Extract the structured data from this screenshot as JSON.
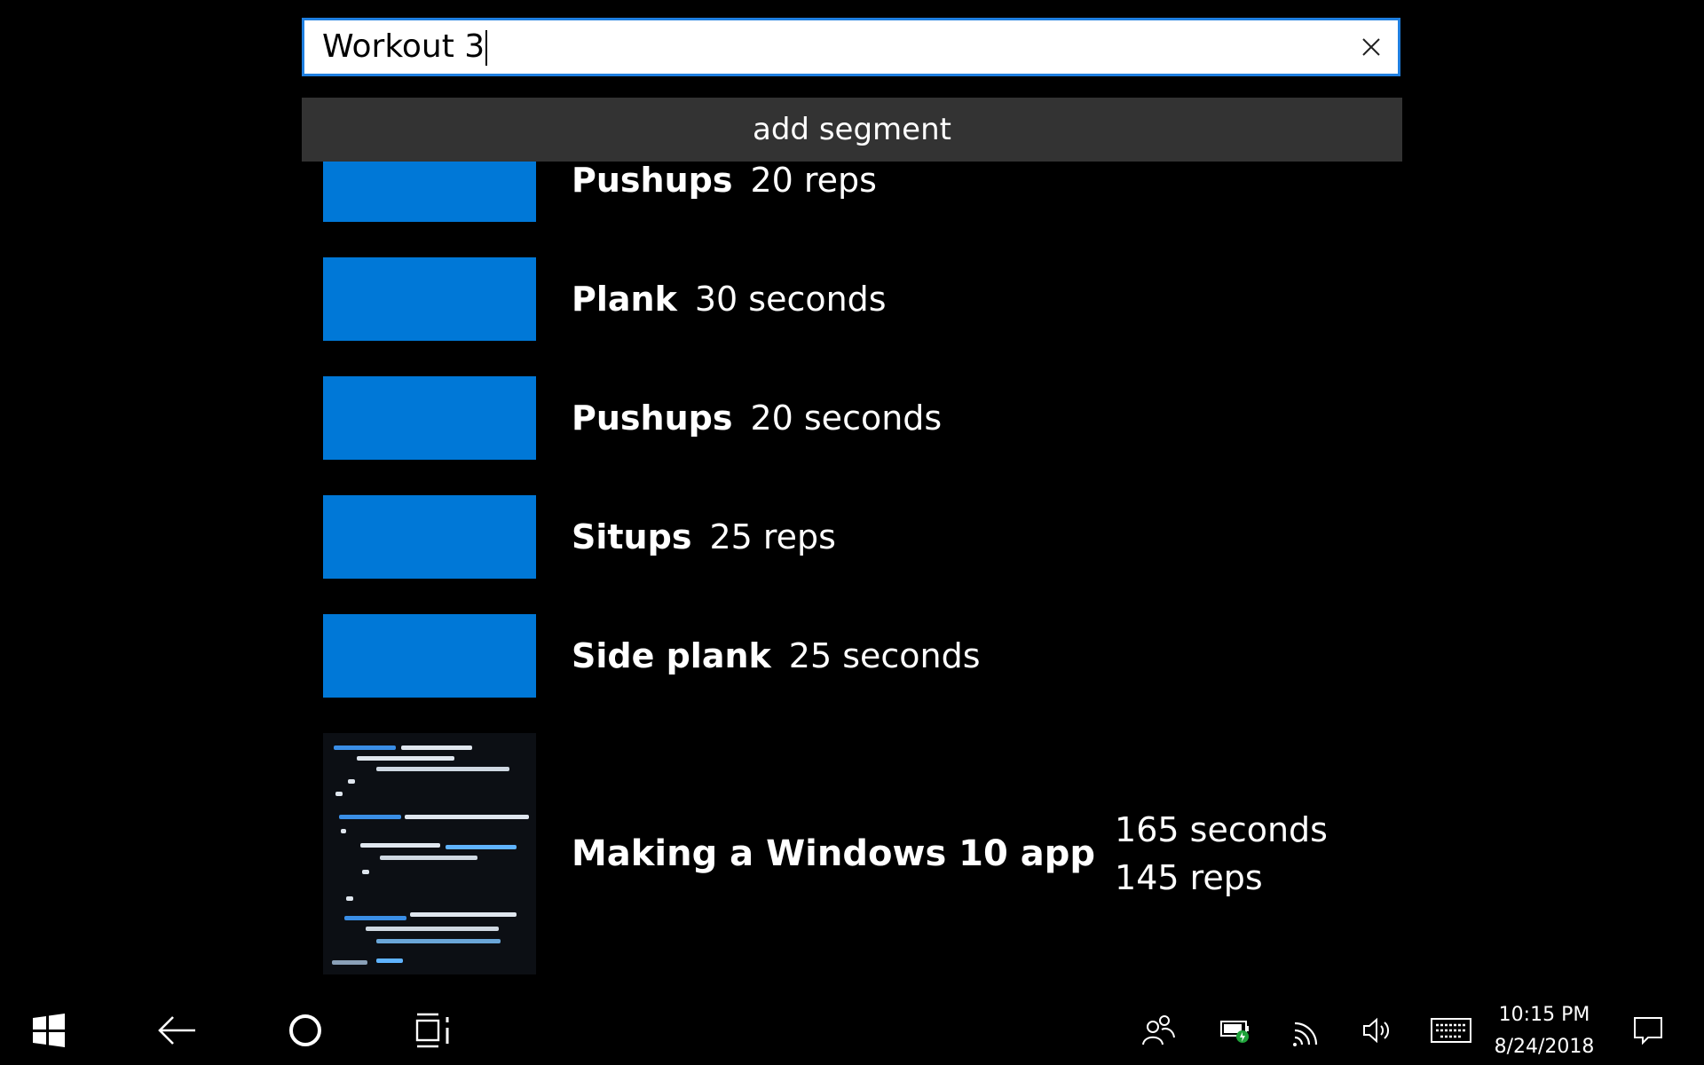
{
  "search": {
    "value": "Workout 3"
  },
  "toolbar": {
    "add_segment_label": "add segment"
  },
  "segments": [
    {
      "name": "Pushups",
      "detail": "20 reps"
    },
    {
      "name": "Plank",
      "detail": "30 seconds"
    },
    {
      "name": "Pushups",
      "detail": "20 seconds"
    },
    {
      "name": "Situps",
      "detail": "25 reps"
    },
    {
      "name": "Side plank",
      "detail": "25 seconds"
    }
  ],
  "workout": {
    "title": "Making a Windows 10 app",
    "seconds": "165 seconds",
    "reps": "145 reps"
  },
  "taskbar": {
    "time": "10:15 PM",
    "date": "8/24/2018",
    "icons": [
      "windows-start-icon",
      "back-arrow-icon",
      "cortana-icon",
      "task-view-icon",
      "people-icon",
      "battery-icon",
      "wifi-icon",
      "volume-icon",
      "keyboard-icon",
      "action-center-icon"
    ]
  },
  "colors": {
    "accent": "#0078d7",
    "search_border": "#1f7fe0",
    "button_bg": "#333333"
  }
}
